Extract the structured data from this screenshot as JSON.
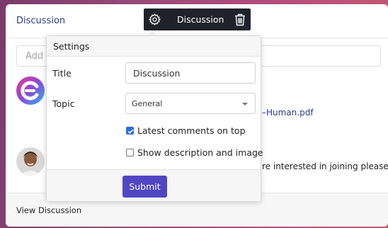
{
  "card": {
    "title": "Discussion",
    "add_placeholder": "Add a",
    "attachment_link": "–Human.pdf",
    "post_text": "re interested in joining please",
    "view_link": "View Discussion"
  },
  "toolbar": {
    "title": "Discussion",
    "icons": [
      "gear-icon",
      "trash-icon"
    ]
  },
  "settings": {
    "header": "Settings",
    "title_label": "Title",
    "title_value": "Discussion",
    "topic_label": "Topic",
    "topic_value": "General",
    "latest_on_top_label": "Latest comments on top",
    "latest_on_top_checked": true,
    "show_desc_label": "Show description and image",
    "show_desc_checked": false,
    "submit_label": "Submit"
  },
  "colors": {
    "accent": "#5046c4",
    "link": "#2c3a8c",
    "checkbox": "#2a6ee0",
    "toolbar_bg": "#1f2228"
  }
}
